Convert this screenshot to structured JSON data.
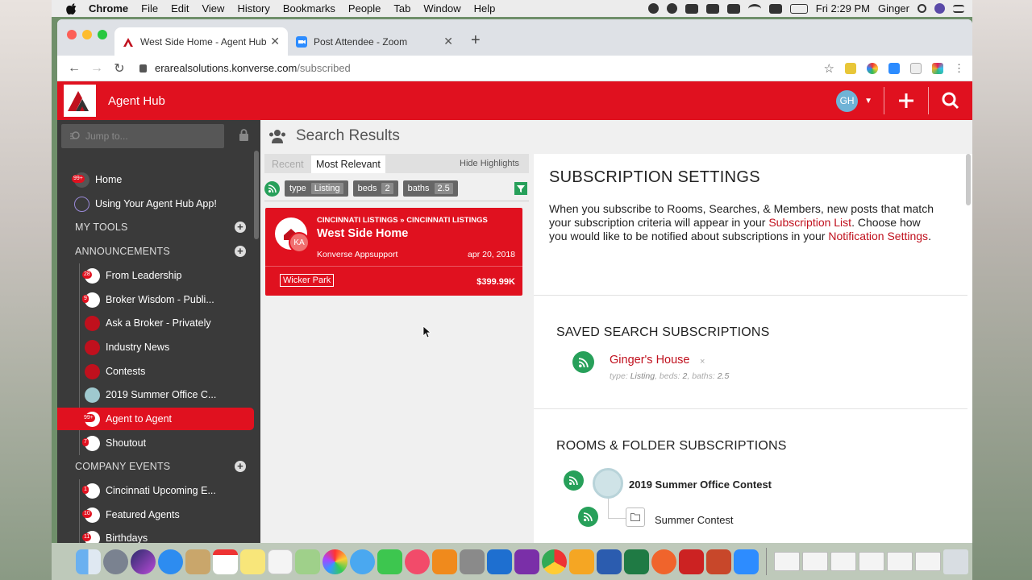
{
  "menubar": {
    "app": "Chrome",
    "items": [
      "File",
      "Edit",
      "View",
      "History",
      "Bookmarks",
      "People",
      "Tab",
      "Window",
      "Help"
    ],
    "clock": "Fri 2:29 PM",
    "user": "Ginger"
  },
  "browser": {
    "tabs": [
      {
        "title": "West Side Home - Agent Hub",
        "active": true
      },
      {
        "title": "Post Attendee - Zoom",
        "active": false
      }
    ],
    "url_host": "erarealsolutions.konverse.com",
    "url_path": "/subscribed"
  },
  "header": {
    "title": "Agent Hub",
    "avatar_initials": "GH",
    "brand_color": "#e0111f"
  },
  "sidebar": {
    "search_placeholder": "Jump to...",
    "top_items": [
      {
        "label": "Home",
        "badge": "99+"
      },
      {
        "label": "Using Your Agent Hub App!",
        "badge": ""
      }
    ],
    "sections": [
      {
        "title": "MY TOOLS"
      },
      {
        "title": "ANNOUNCEMENTS"
      },
      {
        "title": "COMPANY EVENTS"
      }
    ],
    "announcements": [
      {
        "label": "From Leadership",
        "badge": "28"
      },
      {
        "label": "Broker Wisdom - Publi...",
        "badge": "9"
      },
      {
        "label": "Ask a Broker - Privately",
        "badge": ""
      },
      {
        "label": "Industry News",
        "badge": ""
      },
      {
        "label": "Contests",
        "badge": ""
      },
      {
        "label": "2019 Summer Office C...",
        "badge": ""
      },
      {
        "label": "Agent to Agent",
        "badge": "99+",
        "active": true
      },
      {
        "label": "Shoutout",
        "badge": "7"
      }
    ],
    "company_events": [
      {
        "label": "Cincinnati Upcoming E...",
        "badge": "1"
      },
      {
        "label": "Featured Agents",
        "badge": "10"
      },
      {
        "label": "Birthdays",
        "badge": "11"
      }
    ]
  },
  "search_results": {
    "heading": "Search Results",
    "tabs": {
      "recent": "Recent",
      "relevant": "Most Relevant"
    },
    "hide_highlights": "Hide Highlights",
    "filters": [
      {
        "key": "type",
        "value": "Listing"
      },
      {
        "key": "beds",
        "value": "2"
      },
      {
        "key": "baths",
        "value": "2.5"
      }
    ],
    "result": {
      "breadcrumb": "CINCINNATI LISTINGS » CINCINNATI LISTINGS",
      "title": "West Side Home",
      "author": "Konverse Appsupport",
      "avatar_initials": "KA",
      "date": "apr 20, 2018",
      "tag": "Wicker Park",
      "price": "$399.99K"
    }
  },
  "subscription_settings": {
    "title": "SUBSCRIPTION SETTINGS",
    "desc_1": "When you subscribe to Rooms, Searches, & Members, new posts that match your subscription criteria will appear in your ",
    "link_1": "Subscription List",
    "desc_2": ". Choose how you would like to be notified about subscriptions in your ",
    "link_2": "Notification Settings",
    "desc_3": ".",
    "saved_search_heading": "SAVED SEARCH SUBSCRIPTIONS",
    "saved_search": {
      "name": "Ginger's House",
      "remove": "×",
      "criteria": [
        {
          "key": "type:",
          "value": "Listing"
        },
        {
          "key": "beds:",
          "value": "2"
        },
        {
          "key": "baths:",
          "value": "2.5"
        }
      ]
    },
    "rooms_heading": "ROOMS & FOLDER SUBSCRIPTIONS",
    "room": "2019 Summer Office Contest",
    "folder": "Summer Contest"
  },
  "colors": {
    "rss_green": "#27a05a",
    "sidebar_bg": "#3a3a3a",
    "link_red": "#c0101d"
  }
}
